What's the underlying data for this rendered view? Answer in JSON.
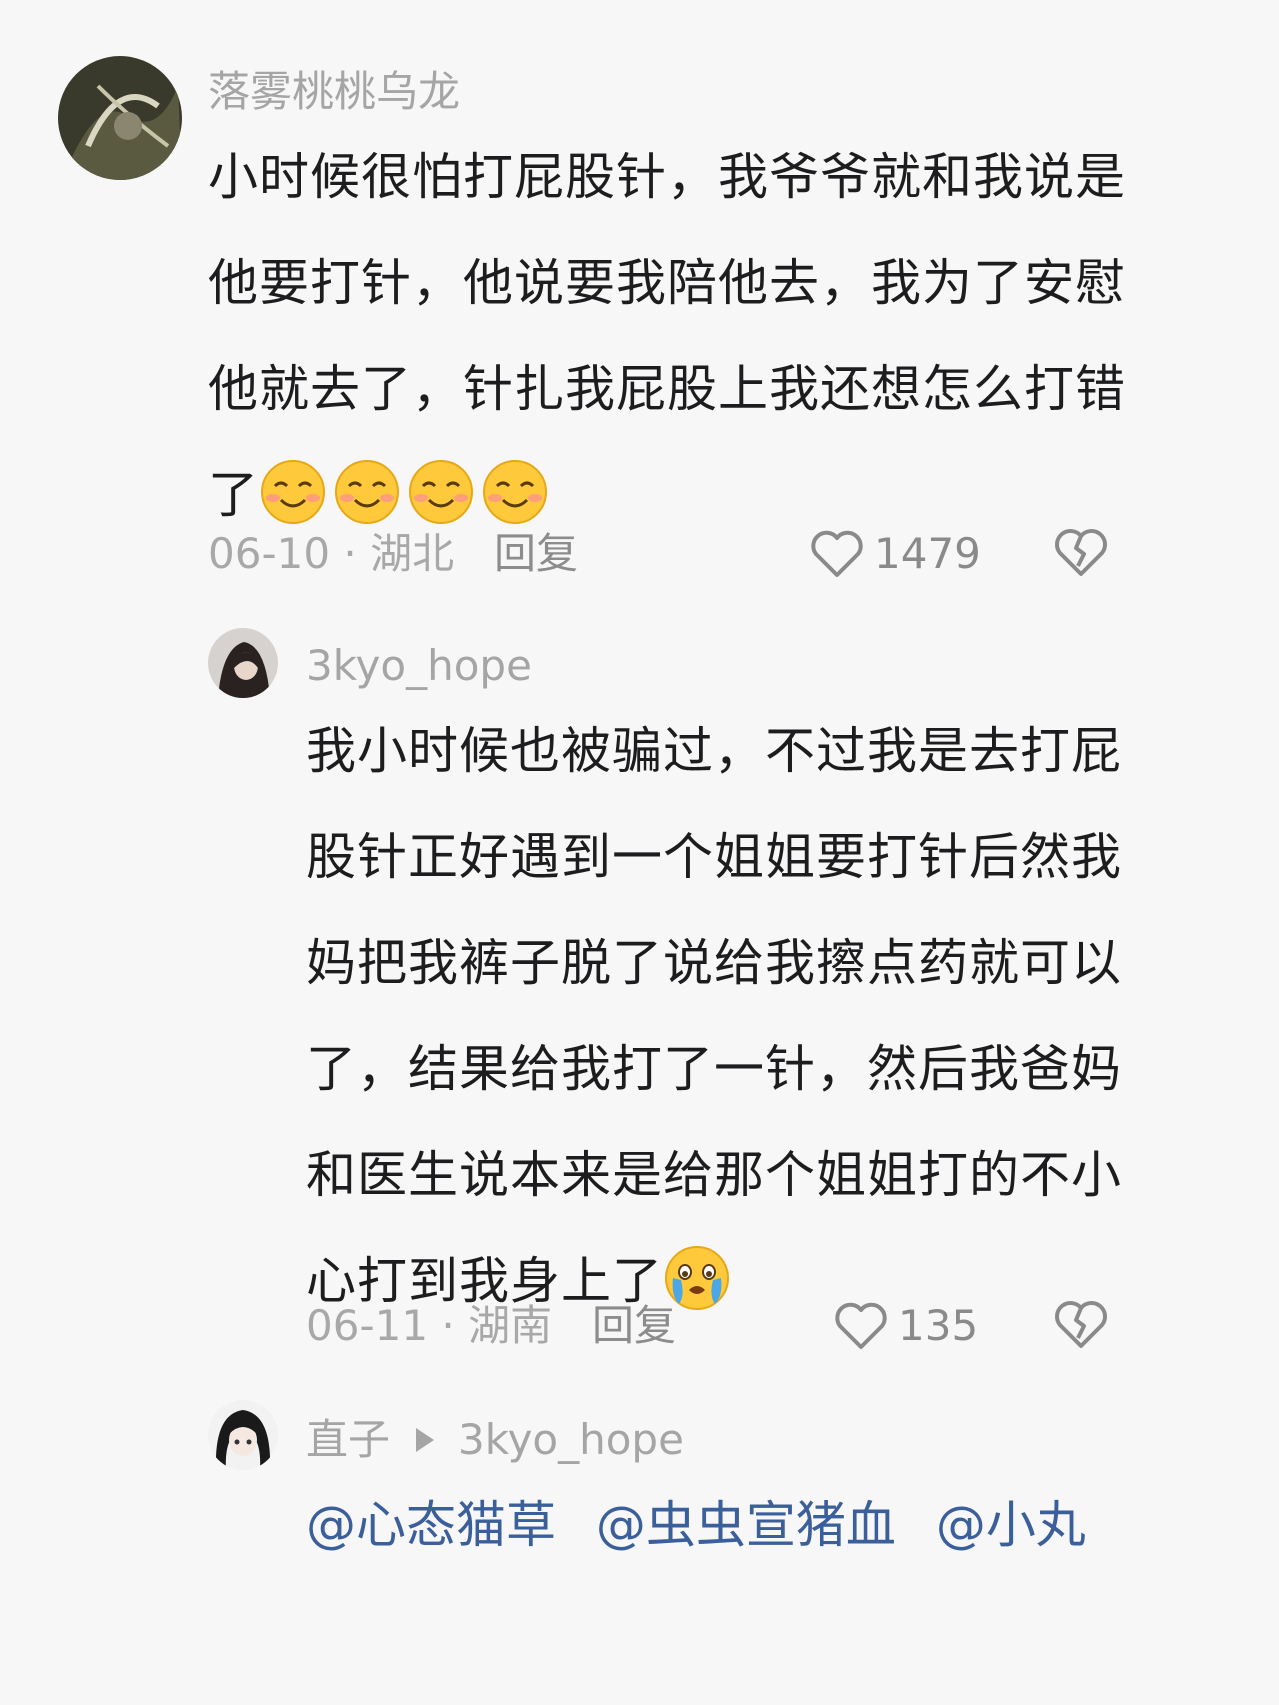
{
  "comments": [
    {
      "username": "落雾桃桃乌龙",
      "text_lines": [
        "小时候很怕打屁股针，我爷爷就和我说是",
        "他要打针，他说要我陪他去，我为了安慰",
        "他就去了，针扎我屁股上我还想怎么打错",
        "了"
      ],
      "emojis": [
        "smiling-face-emoji",
        "smiling-face-emoji",
        "smiling-face-emoji",
        "smiling-face-emoji"
      ],
      "date_location": "06-10 · 湖北",
      "reply_label": "回复",
      "likes": "1479"
    },
    {
      "username": "3kyo_hope",
      "text_lines": [
        "我小时候也被骗过，不过我是去打屁",
        "股针正好遇到一个姐姐要打针后然我",
        "妈把我裤子脱了说给我擦点药就可以",
        "了，结果给我打了一针，然后我爸妈",
        "和医生说本来是给那个姐姐打的不小",
        "心打到我身上了"
      ],
      "emojis": [
        "crying-face-emoji"
      ],
      "date_location": "06-11 · 湖南",
      "reply_label": "回复",
      "likes": "135"
    },
    {
      "username": "直子",
      "reply_to": "3kyo_hope",
      "mentions": [
        "@心态猫草",
        "@虫虫宣猪血",
        "@小丸"
      ]
    }
  ],
  "colors": {
    "background": "#f7f7f7",
    "text": "#1d1d1f",
    "muted": "#a5a5a5",
    "mention": "#3b5f9a"
  }
}
